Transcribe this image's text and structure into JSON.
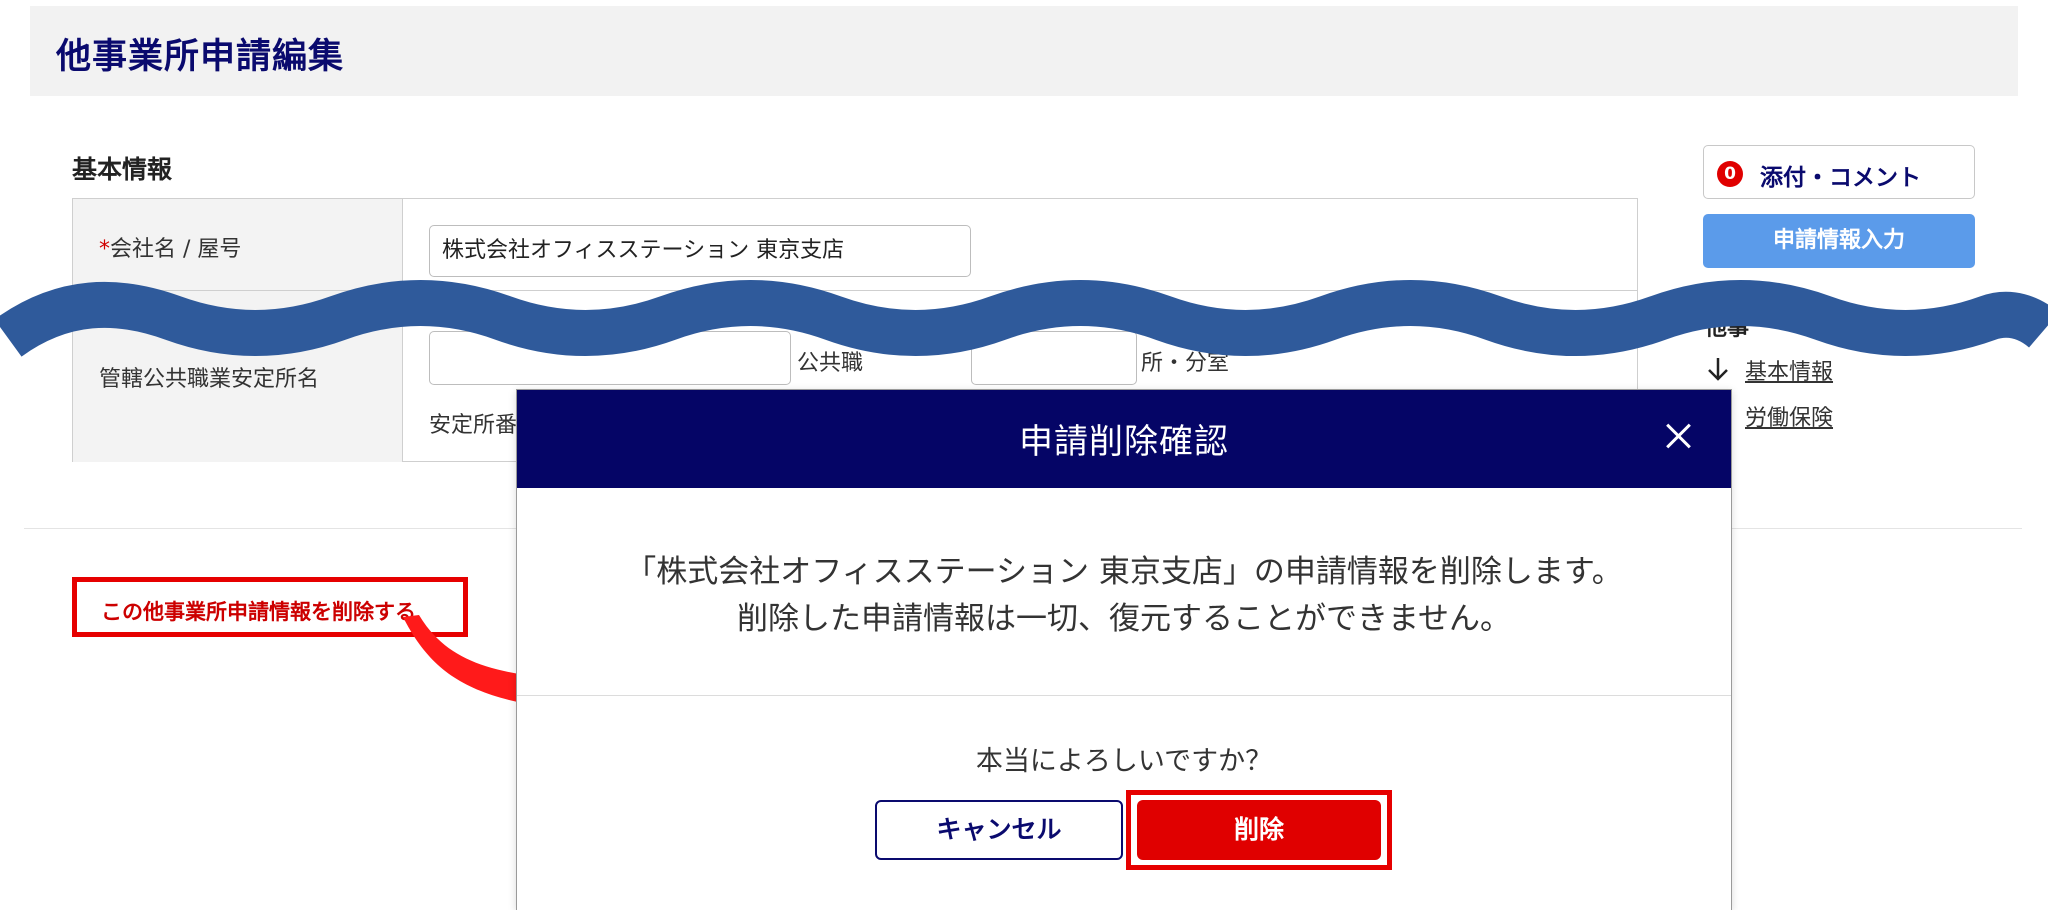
{
  "page": {
    "title": "他事業所申請編集"
  },
  "form": {
    "section_title": "基本情報",
    "company": {
      "required_mark": "*",
      "label": "会社名 / 屋号",
      "value": "株式会社オフィスステーション 東京支店"
    },
    "office": {
      "label": "管轄公共職業安定所名",
      "partial_label_1": "公共職",
      "partial_label_2": "所・分室",
      "partial_label_3": "安定所番"
    }
  },
  "sidebar": {
    "attachment_count": "0",
    "attachment_label": "添付・コメント",
    "input_button": "申請情報入力",
    "links_title": "他事",
    "links": [
      "基本情報",
      "労働保険"
    ]
  },
  "annotation": {
    "text": "この他事業所申請情報を削除する"
  },
  "modal": {
    "title": "申請削除確認",
    "message_line1": "「株式会社オフィスステーション 東京支店」の申請情報を削除します。",
    "message_line2": "削除した申請情報は一切、復元することができません。",
    "question": "本当によろしいですか？",
    "cancel_label": "キャンセル",
    "delete_label": "削除"
  },
  "colors": {
    "navy": "#050566",
    "title_text": "#0a0a6e",
    "accent_blue": "#5b9bea",
    "danger_red": "#e00000",
    "wave_blue": "#2f5a9b"
  }
}
